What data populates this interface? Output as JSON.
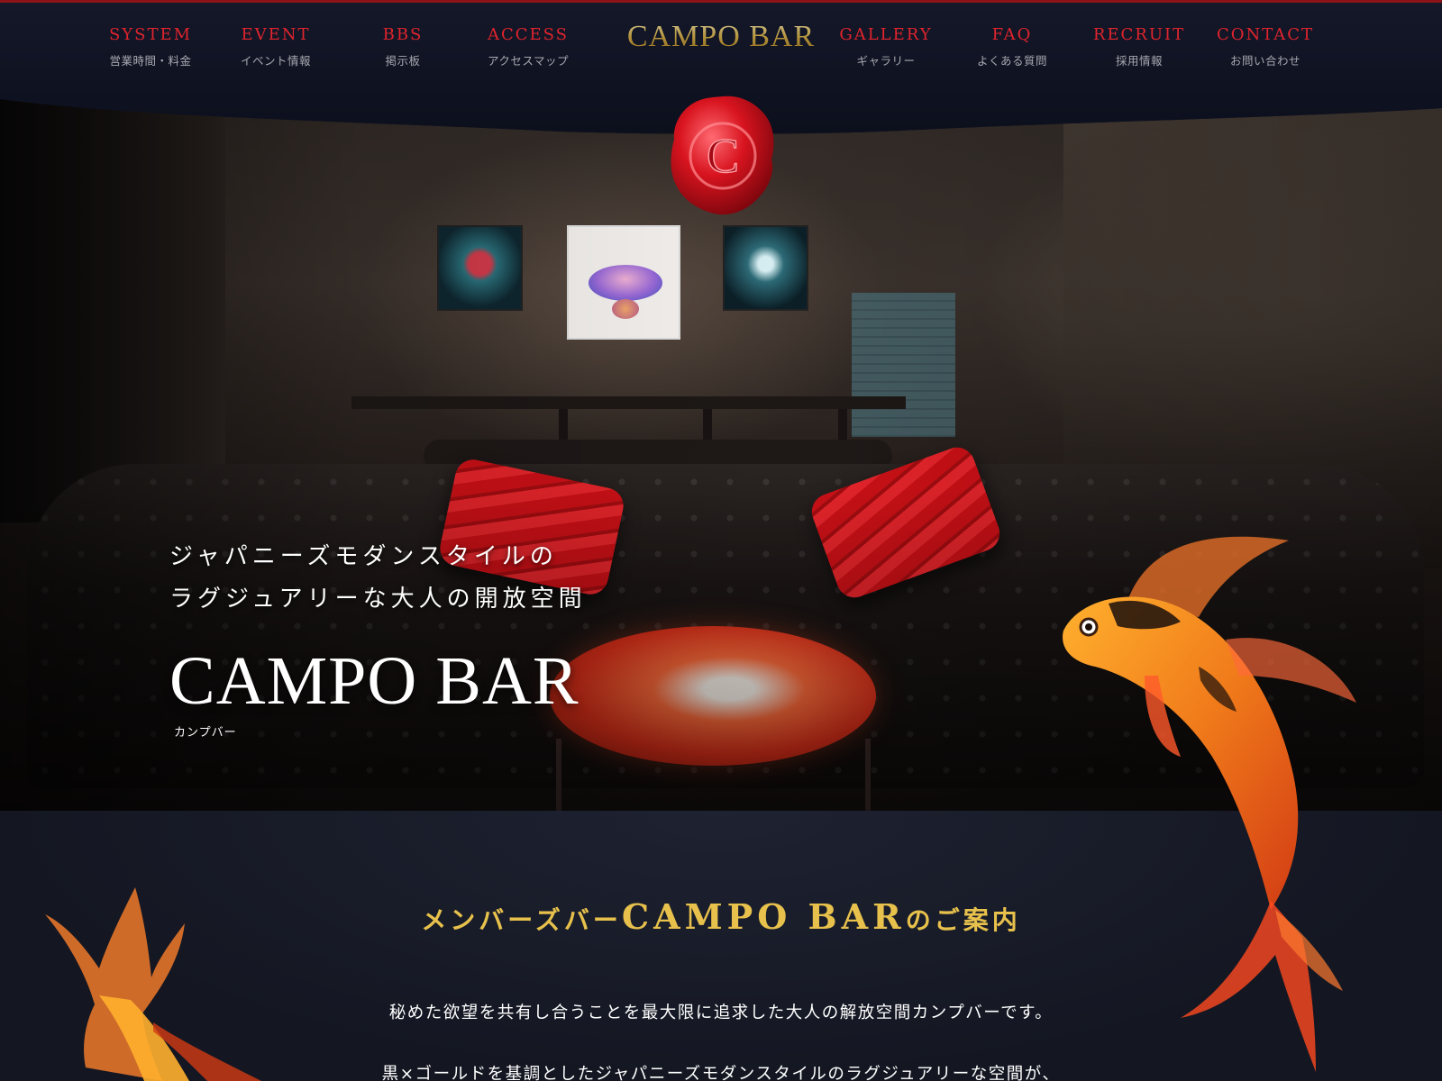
{
  "brand": {
    "logo": "CAMPO BAR",
    "seal_letter": "C"
  },
  "nav": {
    "left": [
      {
        "en": "SYSTEM",
        "jp": "営業時間・料金"
      },
      {
        "en": "EVENT",
        "jp": "イベント情報"
      },
      {
        "en": "BBS",
        "jp": "掲示板"
      },
      {
        "en": "ACCESS",
        "jp": "アクセスマップ"
      }
    ],
    "right": [
      {
        "en": "GALLERY",
        "jp": "ギャラリー"
      },
      {
        "en": "FAQ",
        "jp": "よくある質問"
      },
      {
        "en": "RECRUIT",
        "jp": "採用情報"
      },
      {
        "en": "CONTACT",
        "jp": "お問い合わせ"
      }
    ]
  },
  "hero": {
    "tagline_line1": "ジャパニーズモダンスタイルの",
    "tagline_line2": "ラグジュアリーな大人の開放空間",
    "title": "CAMPO BAR",
    "kana": "カンプバー"
  },
  "about": {
    "title_prefix": "メンバーズバー",
    "title_main": "CAMPO BAR",
    "title_suffix": "のご案内",
    "line1": "秘めた欲望を共有し合うことを最大限に追求した大人の解放空間カンプバーです。",
    "line2": "黒×ゴールドを基調としたジャパニーズモダンスタイルのラグジュアリーな空間が、"
  },
  "colors": {
    "nav_red": "#e0242d",
    "gold": "#e7c14c",
    "header_bg": "#0f1322",
    "section_bg": "#161a26"
  }
}
